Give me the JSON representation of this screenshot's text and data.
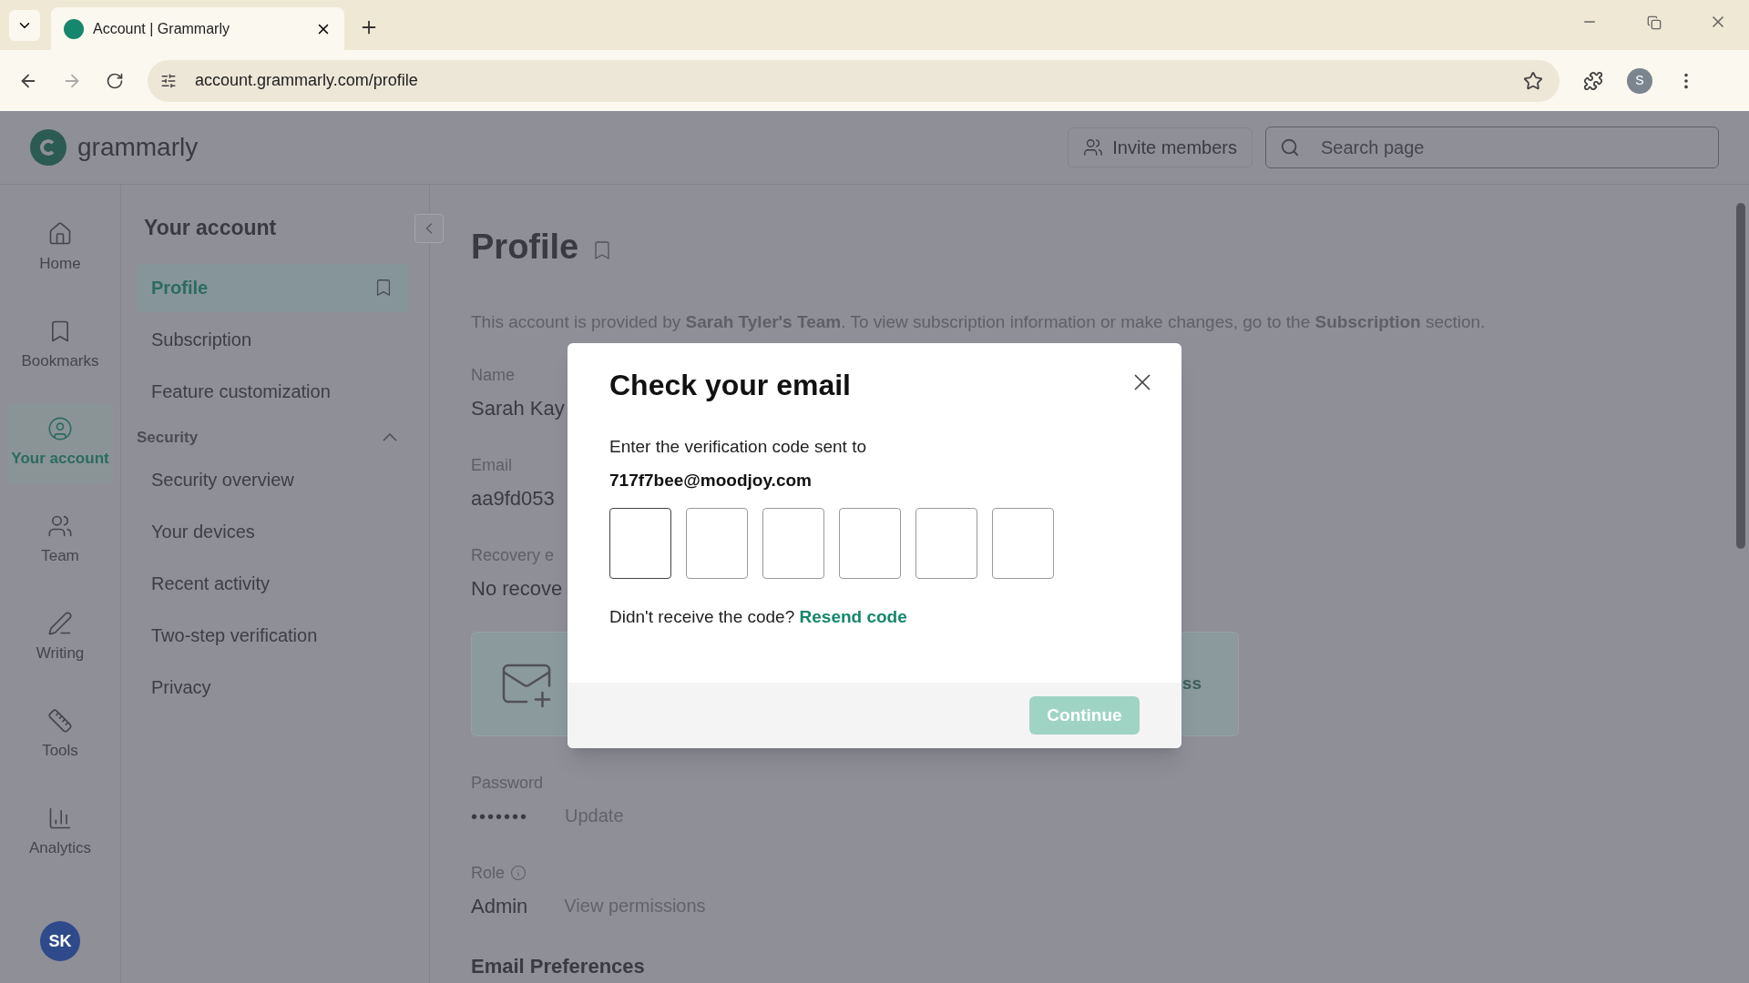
{
  "browser": {
    "tab_title": "Account | Grammarly",
    "address": "account.grammarly.com/profile",
    "profile_initial": "S"
  },
  "header": {
    "logo": "grammarly",
    "invite_button": "Invite members",
    "search": {
      "placeholder": "Search page"
    }
  },
  "rail": {
    "items": [
      {
        "label": "Home",
        "selected": false
      },
      {
        "label": "Bookmarks",
        "selected": false
      },
      {
        "label": "Your account",
        "selected": true
      },
      {
        "label": "Team",
        "selected": false
      },
      {
        "label": "Writing",
        "selected": false
      },
      {
        "label": "Tools",
        "selected": false
      },
      {
        "label": "Analytics",
        "selected": false
      }
    ],
    "avatar": "SK"
  },
  "sidebar": {
    "title": "Your account",
    "items": [
      {
        "kind": "link",
        "label": "Profile",
        "selected": true
      },
      {
        "kind": "link",
        "label": "Subscription",
        "selected": false
      },
      {
        "kind": "link",
        "label": "Feature customization",
        "selected": false
      },
      {
        "kind": "section",
        "label": "Security",
        "expanded": true,
        "children": [
          {
            "label": "Security overview",
            "selected": false
          },
          {
            "label": "Your devices",
            "selected": false
          },
          {
            "label": "Recent activity",
            "selected": false
          },
          {
            "label": "Two-step verification",
            "selected": false
          },
          {
            "label": "Privacy",
            "selected": false
          }
        ]
      }
    ]
  },
  "main": {
    "title": "Profile",
    "notice": "This account is provided by **Sarah Tyler's Team**. To view subscription information or make changes, go to the **Subscription** section.",
    "name": {
      "label": "Name",
      "value": "Sarah Kay"
    },
    "email": {
      "label": "Email",
      "value": "aa9fd053"
    },
    "recovery": {
      "label": "Recovery e",
      "value": "No recove",
      "card_action": "ss"
    },
    "password": {
      "label": "Password",
      "value": "•••••••",
      "action": "Update"
    },
    "role": {
      "label": "Role",
      "value": "Admin",
      "action": "View permissions"
    },
    "next_section": "Email Preferences"
  },
  "modal": {
    "title": "Check your email",
    "text": "Enter the verification code sent to",
    "email": "717f7bee@moodjoy.com",
    "code_boxes": [
      {
        "focused": true
      },
      {
        "focused": false
      },
      {
        "focused": false
      },
      {
        "focused": false
      },
      {
        "focused": false
      },
      {
        "focused": false
      }
    ],
    "resend_prompt": "Didn't receive the code?",
    "resend_link": "Resend code",
    "continue_button": {
      "label": "Continue",
      "disabled": true
    }
  }
}
